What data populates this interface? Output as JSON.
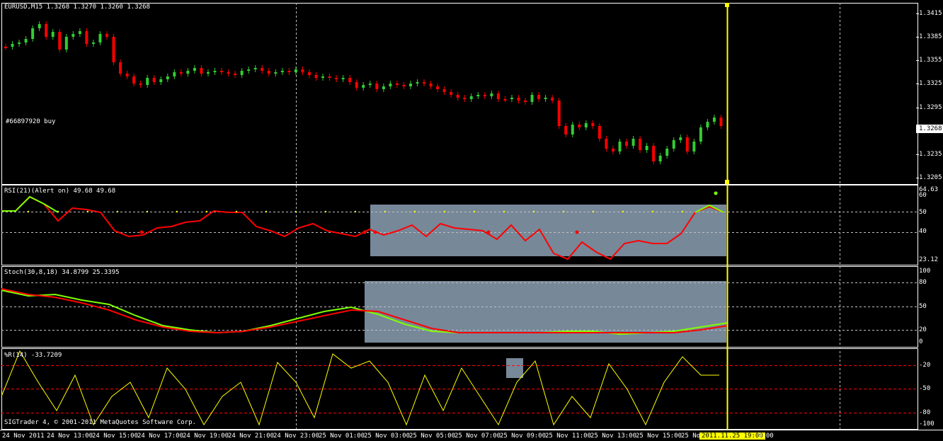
{
  "main": {
    "title": "EURUSD,M15  1.3268 1.3270 1.3260 1.3268",
    "order_label": "#66897920 buy",
    "current_price": "1.3268",
    "price_ticks": [
      "1.3415",
      "1.3385",
      "1.3355",
      "1.3325",
      "1.3295",
      "1.3265",
      "1.3235",
      "1.3205"
    ],
    "colors": {
      "bull": "#32cd32",
      "bear": "#ff0000",
      "background": "#000000",
      "grid": "#c0c0c0",
      "cursor_line": "#ffff00"
    }
  },
  "rsi": {
    "title": "RSI(21)(Alert on) 49.68 49.68",
    "ticks": [
      "64.63",
      "60",
      "50",
      "40",
      "23.12"
    ],
    "colors": {
      "up": "#7fff00",
      "down": "#ff0000",
      "dots": "#ffff00",
      "zone": "#778899"
    }
  },
  "stoch": {
    "title": "Stoch(30,8,18) 34.8799 25.3395",
    "ticks": [
      "100",
      "80",
      "50",
      "20",
      "0"
    ],
    "colors": {
      "main": "#7fff00",
      "signal": "#ff0000",
      "zone": "#778899"
    }
  },
  "wpr": {
    "title": "%R(14) -33.7209",
    "ticks": [
      "-20",
      "-50",
      "-80",
      "-100"
    ],
    "colors": {
      "line": "#ffff00",
      "levels": "#ff0000"
    }
  },
  "copyright": "SIGTrader 4, © 2001-2011 MetaQuotes Software Corp.",
  "time_axis": [
    "24 Nov 2011",
    "24 Nov 13:00",
    "24 Nov 15:00",
    "24 Nov 17:00",
    "24 Nov 19:00",
    "24 Nov 21:00",
    "24 Nov 23:00",
    "25 Nov 01:00",
    "25 Nov 03:00",
    "25 Nov 05:00",
    "25 Nov 07:00",
    "25 Nov 09:00",
    "25 Nov 11:00",
    "25 Nov 13:00",
    "25 Nov 15:00",
    "25 No"
  ],
  "time_cursor": "2011.11.25 19:00",
  "time_tail": "9:00"
}
